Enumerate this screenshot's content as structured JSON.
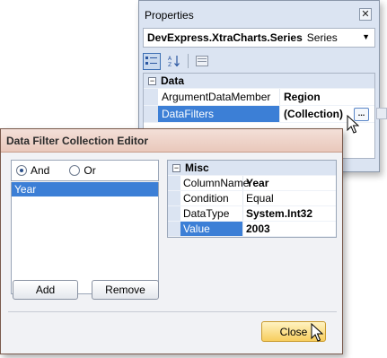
{
  "properties": {
    "title": "Properties",
    "close_glyph": "✕",
    "object_selector": {
      "name": "DevExpress.XtraCharts.Series",
      "type": "Series"
    },
    "toolbar": [
      {
        "icon": "categorized-icon",
        "active": true
      },
      {
        "icon": "alphabetical-icon",
        "active": false
      },
      {
        "icon": "property-pages-icon",
        "active": false
      }
    ],
    "category": "Data",
    "rows": [
      {
        "name": "ArgumentDataMember",
        "value": "Region",
        "selected": false
      },
      {
        "name": "DataFilters",
        "value": "(Collection)",
        "selected": true
      }
    ],
    "ellipsis": "..."
  },
  "editor": {
    "title": "Data Filter Collection Editor",
    "radio": {
      "and_label": "And",
      "or_label": "Or",
      "selected": "And"
    },
    "list": [
      "Year"
    ],
    "add_label": "Add",
    "remove_label": "Remove",
    "close_label": "Close",
    "grid": {
      "category": "Misc",
      "rows": [
        {
          "name": "ColumnName",
          "value": "Year",
          "bold": true,
          "selected": false
        },
        {
          "name": "Condition",
          "value": "Equal",
          "bold": false,
          "selected": false
        },
        {
          "name": "DataType",
          "value": "System.Int32",
          "bold": true,
          "selected": false
        },
        {
          "name": "Value",
          "value": "2003",
          "bold": true,
          "selected": true
        }
      ]
    }
  },
  "colors": {
    "selection": "#3c7fd6",
    "window_bg": "#dbe4f2",
    "dialog_title": "#e9c8bb",
    "close_button": "#f7cd5e"
  }
}
